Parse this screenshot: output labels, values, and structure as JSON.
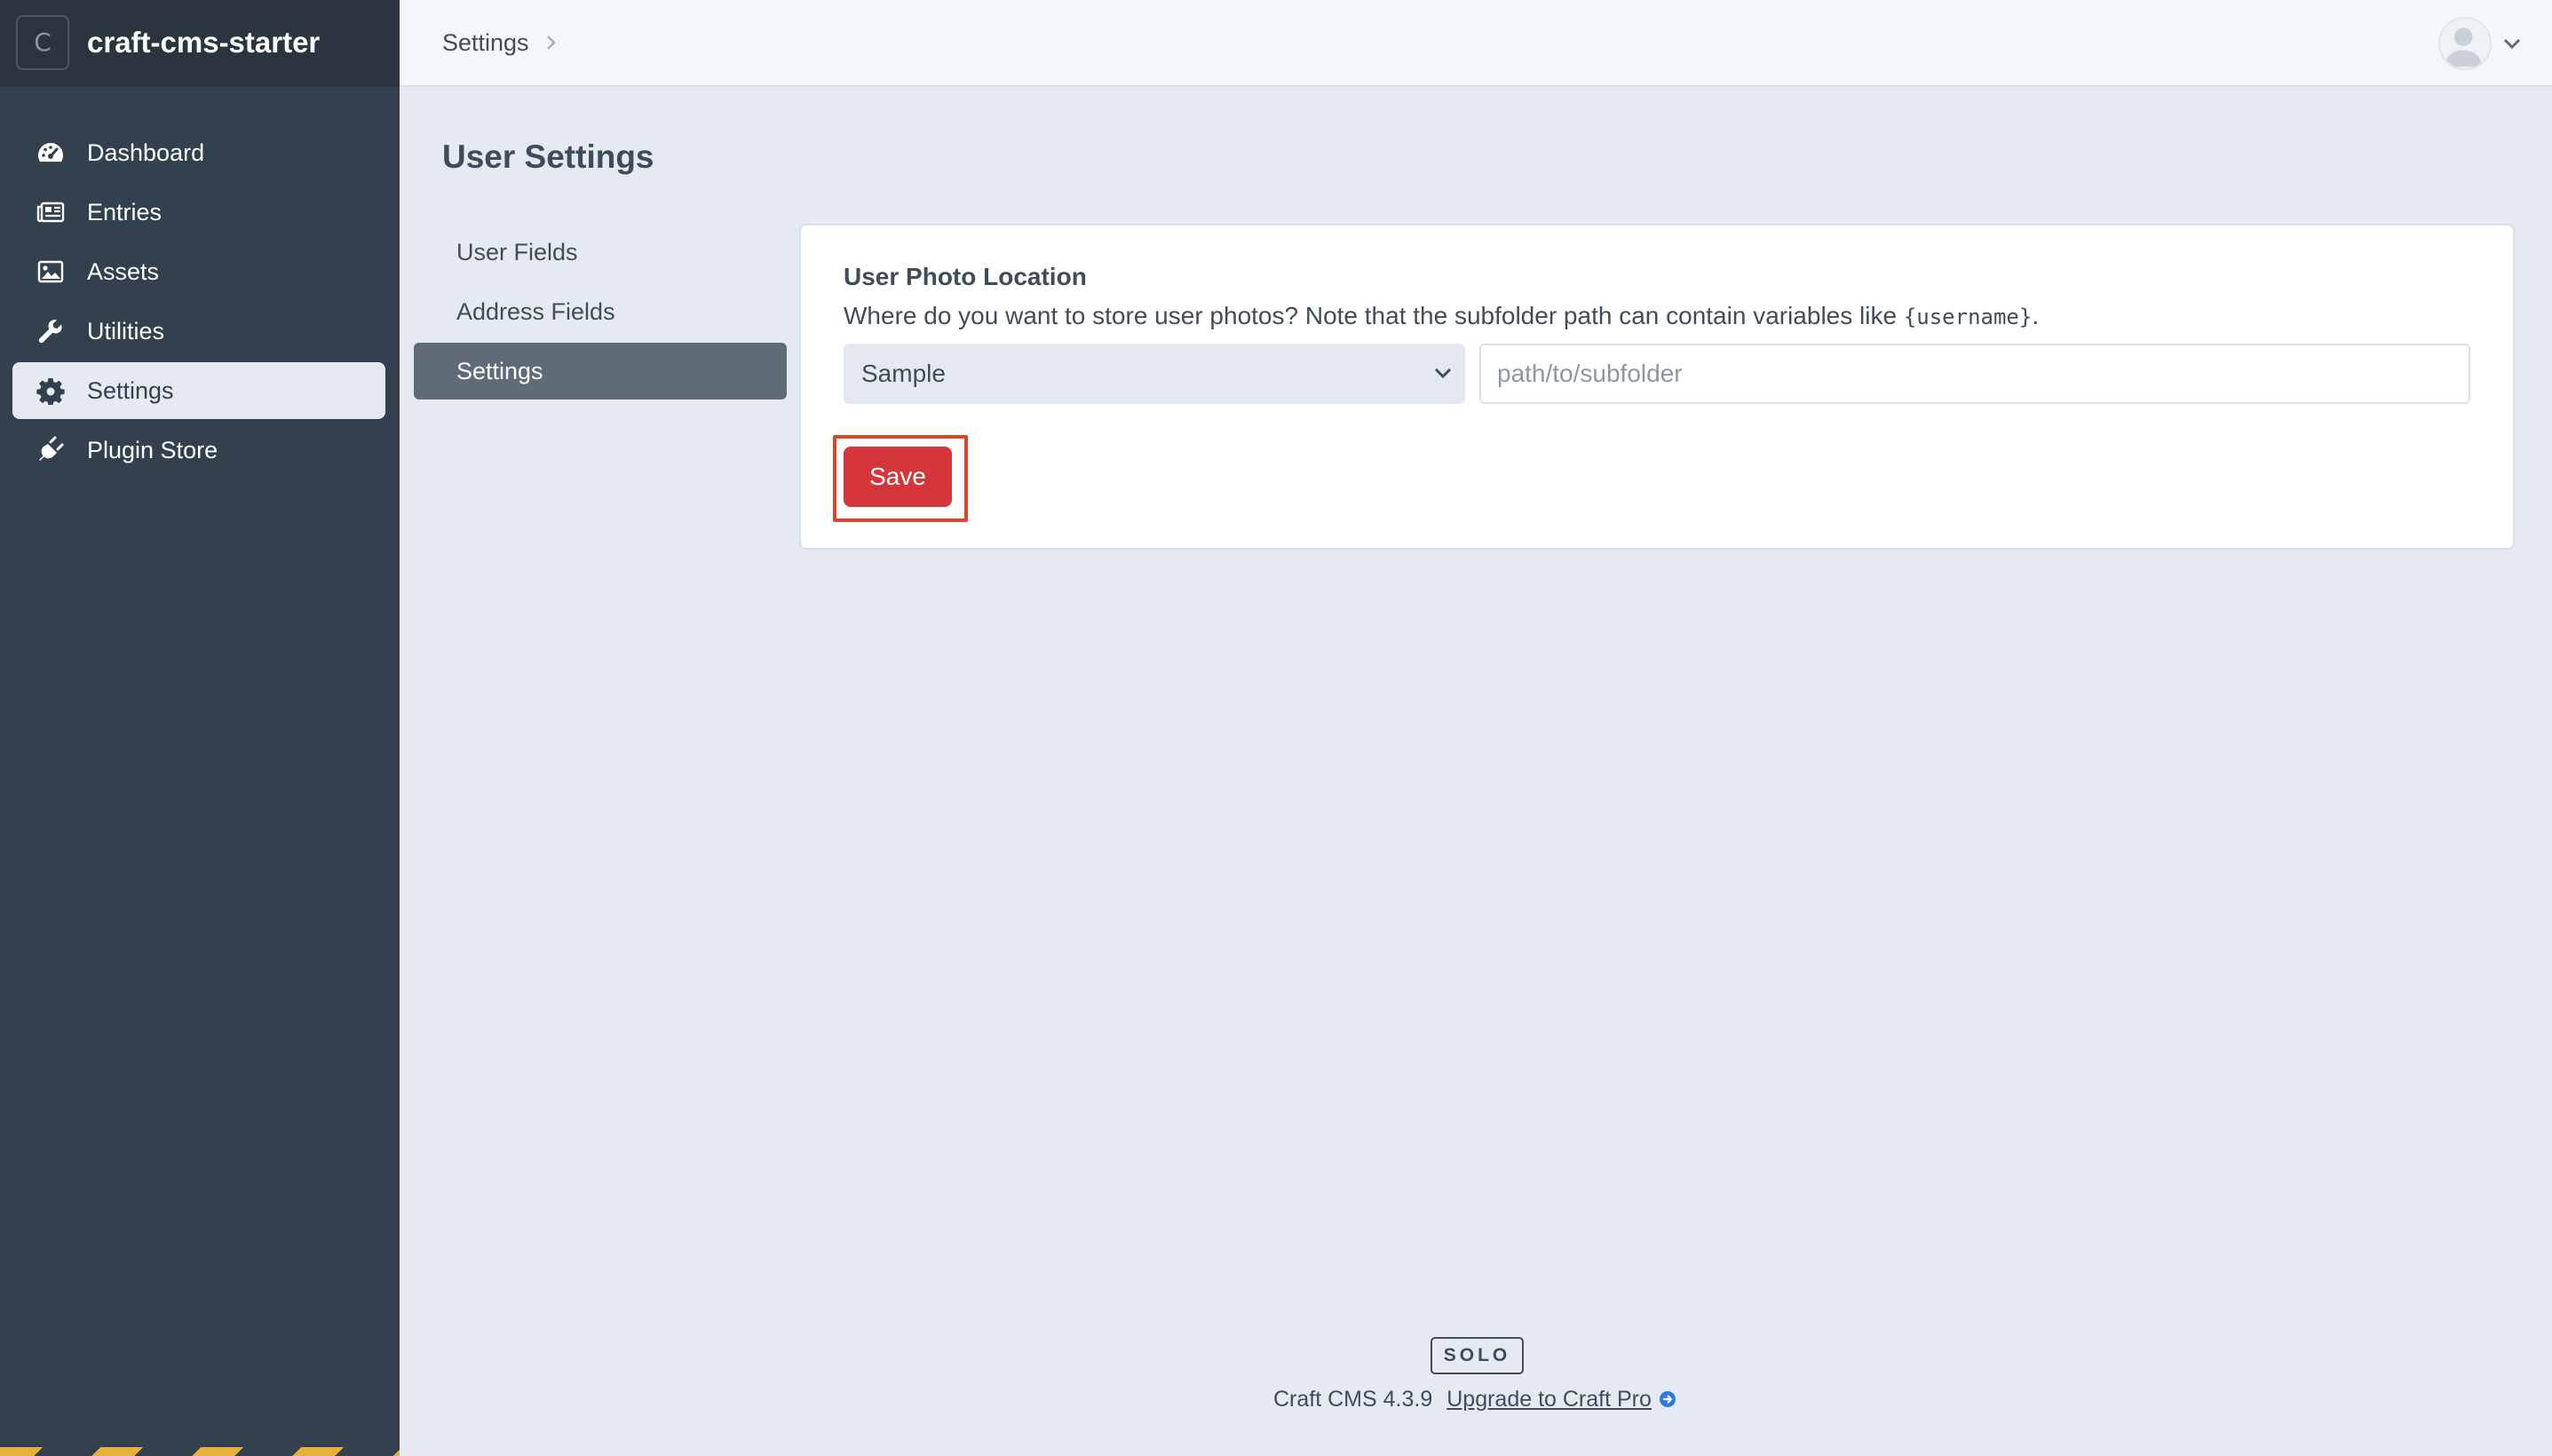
{
  "sidebar": {
    "site_icon_letter": "C",
    "site_name": "craft-cms-starter",
    "items": [
      {
        "label": "Dashboard",
        "icon": "dashboard-gauge-icon"
      },
      {
        "label": "Entries",
        "icon": "newspaper-icon"
      },
      {
        "label": "Assets",
        "icon": "image-icon"
      },
      {
        "label": "Utilities",
        "icon": "wrench-icon"
      },
      {
        "label": "Settings",
        "icon": "gear-icon",
        "active": true
      },
      {
        "label": "Plugin Store",
        "icon": "plug-icon"
      }
    ]
  },
  "header": {
    "breadcrumb": "Settings",
    "account_icon": "user-avatar-icon"
  },
  "main": {
    "title": "User Settings",
    "subnav": [
      {
        "label": "User Fields"
      },
      {
        "label": "Address Fields"
      },
      {
        "label": "Settings",
        "active": true
      }
    ],
    "photo_location": {
      "label": "User Photo Location",
      "instructions_text": "Where do you want to store user photos? Note that the subfolder path can contain variables like ",
      "instructions_code": "{username}",
      "instructions_end": ".",
      "volume_value": "Sample",
      "subpath_value": "",
      "subpath_placeholder": "path/to/subfolder"
    },
    "save_label": "Save"
  },
  "footer": {
    "edition": "SOLO",
    "version": "Craft CMS 4.3.9",
    "upgrade_label": "Upgrade to Craft Pro"
  },
  "colors": {
    "sidebar_bg": "#33404d",
    "accent_red": "#d5363c",
    "highlight_border": "#d9452e",
    "content_bg": "#e4e9f2"
  }
}
